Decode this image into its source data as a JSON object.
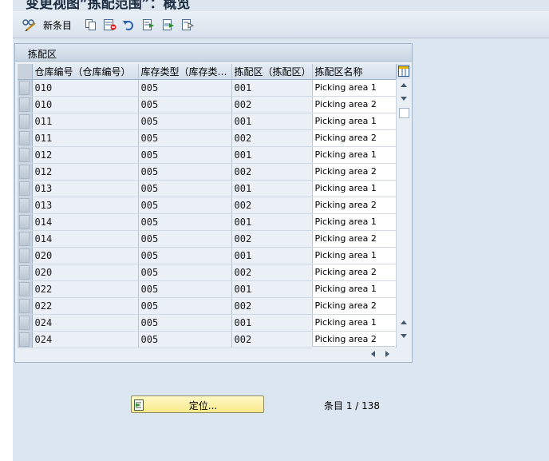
{
  "title": "变更视图“拣配范围”：概览",
  "toolbar": {
    "new_entries_label": "新条目",
    "icons": [
      "glasses-edit-icon",
      "copy-icon",
      "delete-icon",
      "undo-icon",
      "select-all-icon",
      "select-block-icon",
      "deselect-all-icon"
    ]
  },
  "table": {
    "caption": "拣配区",
    "headers": [
      "仓库编号（仓库编号）",
      "库存类型（库存类…",
      "拣配区（拣配区）",
      "拣配区名称"
    ],
    "rows": [
      [
        "010",
        "005",
        "001",
        "Picking area 1"
      ],
      [
        "010",
        "005",
        "002",
        "Picking area 2"
      ],
      [
        "011",
        "005",
        "001",
        "Picking area 1"
      ],
      [
        "011",
        "005",
        "002",
        "Picking area 2"
      ],
      [
        "012",
        "005",
        "001",
        "Picking area 1"
      ],
      [
        "012",
        "005",
        "002",
        "Picking area 2"
      ],
      [
        "013",
        "005",
        "001",
        "Picking area 1"
      ],
      [
        "013",
        "005",
        "002",
        "Picking area 2"
      ],
      [
        "014",
        "005",
        "001",
        "Picking area 1"
      ],
      [
        "014",
        "005",
        "002",
        "Picking area 2"
      ],
      [
        "020",
        "005",
        "001",
        "Picking area 1"
      ],
      [
        "020",
        "005",
        "002",
        "Picking area 2"
      ],
      [
        "022",
        "005",
        "001",
        "Picking area 1"
      ],
      [
        "022",
        "005",
        "002",
        "Picking area 2"
      ],
      [
        "024",
        "005",
        "001",
        "Picking area 1"
      ],
      [
        "024",
        "005",
        "002",
        "Picking area 2"
      ]
    ]
  },
  "footer": {
    "position_button_label": "定位...",
    "entry_label": "条目",
    "entry_current": "1",
    "entry_total": "138"
  },
  "colors": {
    "background": "#dce6f0",
    "button_yellow": "#f8e98a",
    "header": "#d3deea"
  }
}
